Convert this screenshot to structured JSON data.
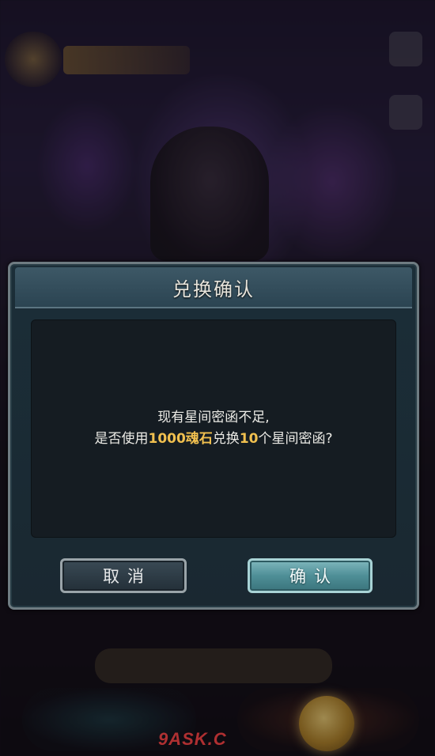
{
  "dialog": {
    "title": "兑换确认",
    "message": {
      "line1": "现有星间密函不足,",
      "line2_prefix": "是否使用",
      "line2_cost": "1000魂石",
      "line2_middle": "兑换",
      "line2_amount": "10",
      "line2_suffix": "个星间密函?"
    },
    "cancel_label": "取消",
    "confirm_label": "确认"
  },
  "watermark": "9ASK.C",
  "colors": {
    "highlight": "#f1c04f",
    "confirm_button": "#4f8f97",
    "cancel_button": "#2e3c46"
  }
}
